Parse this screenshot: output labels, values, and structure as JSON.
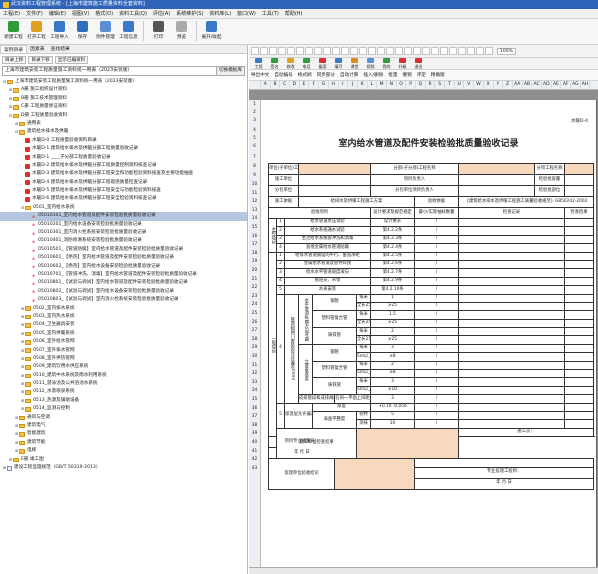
{
  "app": {
    "title": "武汉资料工程管理系统 - [上海市建筑施工质量资料全套资料]",
    "colors": {
      "titlebar": "#2e63b8",
      "accent_orange": "#f8d9bd",
      "tree_selected": "#b6c6e0"
    }
  },
  "menu": [
    "工程(E)",
    "文件(F)",
    "编辑(E)",
    "视图(V)",
    "格式(O)",
    "资料工具(Q)",
    "评估(A)",
    "系统维护(S)",
    "资料库(L)",
    "窗口(W)",
    "工具(T)",
    "帮助(H)"
  ],
  "toolbar": [
    {
      "label": "新建工程",
      "icon": "new-project",
      "color": "#2f9c3a"
    },
    {
      "label": "打开工程",
      "icon": "open-project",
      "color": "#e0a21e"
    },
    {
      "label": "工程导入",
      "icon": "import",
      "color": "#3a78c9"
    },
    {
      "label": "保存",
      "icon": "save",
      "color": "#2f6fbf"
    },
    {
      "label": "附件管理",
      "icon": "attachment",
      "color": "#5a8fd6"
    },
    {
      "label": "工程信息",
      "icon": "info",
      "color": "#3a78c9"
    },
    {
      "label": "打印",
      "icon": "print",
      "color": "#555"
    },
    {
      "label": "预览",
      "icon": "preview",
      "color": "#aaa"
    },
    {
      "label": "展开/收起",
      "icon": "expand",
      "color": "#3a78c9"
    }
  ],
  "left": {
    "tabs": [
      "案例目录",
      "因素表",
      "查找结果"
    ],
    "search_btns": [
      "目录上移",
      "目录下移",
      "显示已编资料"
    ],
    "combo": "上海市建筑安装工程质量施工资料统一用表（2023安装版）",
    "combo_btn": "切换模板库",
    "tree": [
      {
        "d": 0,
        "t": "fold",
        "x": "-",
        "l": "上海市建筑安装工程质量施工资料统一用表（2023安装版）"
      },
      {
        "d": 1,
        "t": "fold",
        "x": "+",
        "l": "A册 施工组织设计资料"
      },
      {
        "d": 1,
        "t": "fold",
        "x": "+",
        "l": "B册 施工技术管理资料"
      },
      {
        "d": 1,
        "t": "fold",
        "x": "+",
        "l": "C册 工程质量保证资料"
      },
      {
        "d": 1,
        "t": "fold",
        "x": "-",
        "l": "D册 工程质量验收资料"
      },
      {
        "d": 2,
        "t": "fold",
        "x": "+",
        "l": "通用表"
      },
      {
        "d": 2,
        "t": "fold",
        "x": "-",
        "l": "建筑给水排水及供暖"
      },
      {
        "d": 3,
        "t": "red",
        "x": "",
        "l": "水暖D-0 工程质量验收资料目录"
      },
      {
        "d": 3,
        "t": "red",
        "x": "",
        "l": "水暖D-1 建筑给水排水及供暖分部工程质量验收记录"
      },
      {
        "d": 3,
        "t": "red",
        "x": "",
        "l": "水暖D-1 ____子分部工程质量验收记录"
      },
      {
        "d": 3,
        "t": "red",
        "x": "",
        "l": "水暖D-2 建筑给水排水及供暖分部工程质量控制资料核查记录"
      },
      {
        "d": 3,
        "t": "red",
        "x": "",
        "l": "水暖D-3 建筑给水排水及供暖分部工程安全和功能检验资料核查及主要功能抽查"
      },
      {
        "d": 3,
        "t": "red",
        "x": "",
        "l": "水暖D-4 建筑给水排水及供暖分部工程观感质量检查记录"
      },
      {
        "d": 3,
        "t": "red",
        "x": "",
        "l": "水暖D-5 建筑给水排水及供暖分部工程安全与功能检验资料核查"
      },
      {
        "d": 3,
        "t": "red",
        "x": "",
        "l": "水暖D-6 建筑给水排水及供暖分部工程安全检验资料核查记录"
      },
      {
        "d": 3,
        "t": "fold",
        "x": "-",
        "l": "0501_室内给水系统"
      },
      {
        "d": 4,
        "t": "leaf",
        "x": "",
        "l": "05010101_室内给水管道及配件安装检验批质量验收记录",
        "sel": true
      },
      {
        "d": 4,
        "t": "leaf",
        "x": "",
        "l": "05010201_室内给水设备安装检验批质量验收记录"
      },
      {
        "d": 4,
        "t": "leaf",
        "x": "",
        "l": "05010301_室内消火栓系统安装检验批质量验收记录"
      },
      {
        "d": 4,
        "t": "leaf",
        "x": "",
        "l": "05010401_消防喷淋系统安装检验批质量验收记录"
      },
      {
        "d": 4,
        "t": "leaf",
        "x": "",
        "l": "05010501_【管道防腐】室内给水管道及配件安装检验批质量验收记录"
      },
      {
        "d": 4,
        "t": "leaf",
        "x": "",
        "l": "05010601_【绝热】室内给水管道及配件安装检验批质量验收记录"
      },
      {
        "d": 4,
        "t": "leaf",
        "x": "",
        "l": "05010602_【绝热】室内给水设备安装检验批质量验收记录"
      },
      {
        "d": 4,
        "t": "leaf",
        "x": "",
        "l": "05010701_【管道冲洗、消毒】室内给水管道及配件安装检验批质量验收记录"
      },
      {
        "d": 4,
        "t": "leaf",
        "x": "",
        "l": "05010801_【试验与调试】室内给水管道及配件安装检验批质量验收记录"
      },
      {
        "d": 4,
        "t": "leaf",
        "x": "",
        "l": "05010802_【试验与调试】室内给水设备安装检验批质量验收记录"
      },
      {
        "d": 4,
        "t": "leaf",
        "x": "",
        "l": "05010803_【试验与调试】室内消火栓系统安装检验批质量验收记录"
      },
      {
        "d": 3,
        "t": "fold",
        "x": "+",
        "l": "0502_室内排水系统"
      },
      {
        "d": 3,
        "t": "fold",
        "x": "+",
        "l": "0503_室内热水系统"
      },
      {
        "d": 3,
        "t": "fold",
        "x": "+",
        "l": "0504_卫生器具安装"
      },
      {
        "d": 3,
        "t": "fold",
        "x": "+",
        "l": "0505_室内供暖系统"
      },
      {
        "d": 3,
        "t": "fold",
        "x": "+",
        "l": "0506_室外给水管网"
      },
      {
        "d": 3,
        "t": "fold",
        "x": "+",
        "l": "0507_室外排水管网"
      },
      {
        "d": 3,
        "t": "fold",
        "x": "+",
        "l": "0508_室外供热管网"
      },
      {
        "d": 3,
        "t": "fold",
        "x": "+",
        "l": "0509_建筑饮用水供应系统"
      },
      {
        "d": 3,
        "t": "fold",
        "x": "+",
        "l": "0510_建筑中水系统及雨水利用系统"
      },
      {
        "d": 3,
        "t": "fold",
        "x": "+",
        "l": "0511_游泳池及公共浴池水系统"
      },
      {
        "d": 3,
        "t": "fold",
        "x": "+",
        "l": "0512_水景喷泉系统"
      },
      {
        "d": 3,
        "t": "fold",
        "x": "+",
        "l": "0513_热源及辅助设备"
      },
      {
        "d": 3,
        "t": "fold",
        "x": "+",
        "l": "0514_监测与控制"
      },
      {
        "d": 2,
        "t": "fold",
        "x": "+",
        "l": "通风与空调"
      },
      {
        "d": 2,
        "t": "fold",
        "x": "+",
        "l": "建筑电气"
      },
      {
        "d": 2,
        "t": "fold",
        "x": "+",
        "l": "智能建筑"
      },
      {
        "d": 2,
        "t": "fold",
        "x": "+",
        "l": "建筑节能"
      },
      {
        "d": 2,
        "t": "fold",
        "x": "+",
        "l": "电梯"
      },
      {
        "d": 1,
        "t": "fold",
        "x": "+",
        "l": "E册 竣工图"
      },
      {
        "d": 0,
        "t": "doc",
        "x": "+",
        "l": "建设工程监理规范（GB/T 50319-2013）"
      }
    ]
  },
  "right": {
    "tb2": [
      {
        "l": "工程",
        "c": "#3a78c9"
      },
      {
        "l": "签名",
        "c": "#2f9c3a"
      },
      {
        "l": "修改",
        "c": "#e0a21e"
      },
      {
        "l": "电话",
        "c": "#2f9c3a"
      },
      {
        "l": "备案",
        "c": "#d9302c"
      },
      {
        "l": "填写",
        "c": "#3a78c9"
      },
      {
        "l": "课堂",
        "c": "#e08a1e"
      },
      {
        "l": "视频",
        "c": "#5a8fd6"
      },
      {
        "l": "我的",
        "c": "#2f9c3a"
      },
      {
        "l": "升级",
        "c": "#d9302c"
      },
      {
        "l": "退出",
        "c": "#d9302c"
      }
    ],
    "tb3": [
      "导出中文",
      "自动编号",
      "格式刷",
      "同步部分",
      "自动计算",
      "插入/删除",
      "批量",
      "撤销",
      "评定",
      "精确版"
    ],
    "zoom": "100%",
    "cols": [
      "A",
      "B",
      "C",
      "D",
      "E",
      "F",
      "G",
      "H",
      "I",
      "J",
      "K",
      "L",
      "M",
      "N",
      "O",
      "P",
      "Q",
      "R",
      "S",
      "T",
      "U",
      "V",
      "W",
      "X",
      "Y",
      "Z",
      "AA",
      "AB",
      "AC",
      "AD",
      "AE",
      "AF",
      "AG",
      "AH"
    ],
    "rows": [
      "1",
      "2",
      "3",
      "4",
      "5",
      "6",
      "7",
      "8",
      "9",
      "10",
      "11",
      "12",
      "13",
      "14",
      "15",
      "16",
      "17",
      "18",
      "19",
      "20",
      "21",
      "22",
      "23",
      "24",
      "25",
      "26",
      "27",
      "28",
      "29",
      "30",
      "31",
      "32",
      "33",
      "34",
      "35",
      "36",
      "37",
      "38",
      "39",
      "40",
      "41",
      "42",
      "43"
    ],
    "form": {
      "code": "水暖D-4",
      "title": "室内给水管道及配件安装检验批质量验收记录",
      "unit_proj": "单位(子单位)工程名称",
      "sub_part": "分部(子分部)工程名称",
      "item_name": "分项工程名称",
      "contractor": "施工单位",
      "proj_mgr": "项目负责人",
      "batch_cap": "检验批容量",
      "sub_unit": "分包单位",
      "sub_mgr": "分包单位项目负责人",
      "batch_loc": "检验批部位",
      "basis": "施工依据",
      "basis_v": "给排水及供暖工程施工方案",
      "acc_basis": "验收依据",
      "acc_basis_v": "《建筑给水排水及供暖工程施工质量验收规范》GB50242-2002",
      "h_item": "验收项目",
      "h_req": "设计要求及规范规定",
      "h_min": "最小/实际抽样数量",
      "h_check": "检查记录",
      "h_result": "检查结果",
      "main_ctrl": "主控项目",
      "main": [
        [
          "1",
          "给水管道水压试验",
          "设计要求",
          "/"
        ],
        [
          "2",
          "给水系统通水试验",
          "第4.2.2条",
          "/"
        ],
        [
          "3",
          "生活给水系统管冲洗和消毒",
          "第4.2.3条",
          "/"
        ],
        [
          "4",
          "直埋金属给水管道防腐",
          "第4.2.4条",
          "/"
        ]
      ],
      "gen": [
        [
          "1",
          "给排水管道铺设的平行、垂直净距",
          "第4.2.5条",
          "/"
        ],
        [
          "2",
          "金属给水管道及管件焊接",
          "第4.2.6条",
          "/"
        ],
        [
          "3",
          "给水水平管道坡度坡向",
          "第4.2.7条",
          "/"
        ],
        [
          "4",
          "管道支、吊架",
          "第4.2.9条",
          "/"
        ],
        [
          "5",
          "水表安装",
          "第4.2.10条",
          "/"
        ]
      ],
      "gen_label": "一般项目",
      "dev_label": "管道和阀门安装的允许偏差(mm)",
      "dev": [
        [
          "钢管",
          "每米",
          "1"
        ],
        [
          "",
          "全长25m以上",
          "≯25"
        ],
        [
          "塑料管复合管",
          "每米",
          "1.5"
        ],
        [
          "",
          "全长25m以上",
          "≯25"
        ],
        [
          "铸铁管",
          "每米",
          "2"
        ],
        [
          "",
          "全长25m以上",
          "≯25"
        ],
        [
          "钢管",
          "每米",
          "3"
        ],
        [
          "",
          "5m以上",
          "≯8"
        ],
        [
          "塑料管复合管",
          "每米",
          "2"
        ],
        [
          "",
          "5m以上",
          "≯8"
        ],
        [
          "铸铁管",
          "每米",
          "3"
        ],
        [
          "",
          "5m以上",
          "≯10"
        ]
      ],
      "dev_h": "水平管道纵横方向弯曲",
      "dev_v": "立管垂直度",
      "dev_row": [
        "成排管段和成排阀门",
        "在同一平面上间距",
        "3"
      ],
      "ins_label": "保温层允许偏差(mm)",
      "ins": [
        [
          "厚度",
          "+0.1δ -0.05δ"
        ],
        [
          "卷材",
          "5"
        ],
        [
          "涂抹",
          "10"
        ]
      ],
      "ins_flat": "表面平整度",
      "sign_contractor": "施工单位检查结果",
      "sign_eng": "施工员：",
      "sign_qc": "项目专业质量员：",
      "sign_sup": "监理单位验收结论",
      "sign_sup_eng": "专业监理工程师：",
      "ymd": "年  月  日"
    }
  }
}
